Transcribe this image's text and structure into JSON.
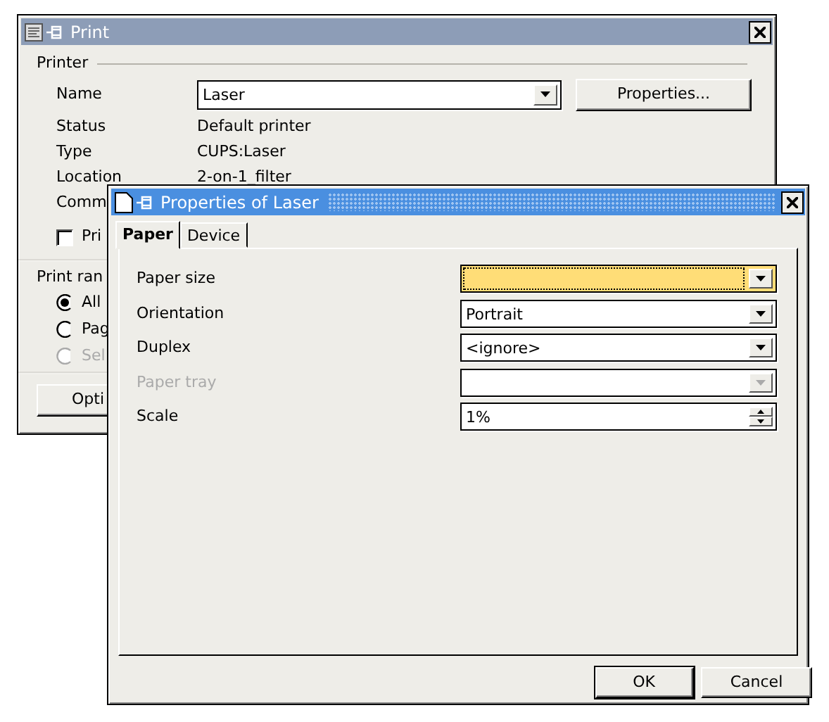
{
  "print_dialog": {
    "title": "Print",
    "printer_group": {
      "label": "Printer",
      "name_label": "Name",
      "name_value": "Laser",
      "properties_button": "Properties...",
      "info": [
        {
          "label": "Status",
          "value": "Default printer"
        },
        {
          "label": "Type",
          "value": "CUPS:Laser"
        },
        {
          "label": "Location",
          "value": "2-on-1_filter"
        },
        {
          "label": "Comm"
        }
      ]
    },
    "print_to_file": {
      "label": "Pri",
      "checked": false
    },
    "range_group": {
      "label": "Print ran",
      "options": [
        {
          "label": "All",
          "selected": true,
          "disabled": false
        },
        {
          "label": "Pag",
          "selected": false,
          "disabled": false
        },
        {
          "label": "Sel",
          "selected": false,
          "disabled": true
        }
      ]
    },
    "options_button": "Opti"
  },
  "properties_dialog": {
    "title": "Properties of Laser",
    "tabs": [
      {
        "label": "Paper",
        "selected": true
      },
      {
        "label": "Device",
        "selected": false
      }
    ],
    "fields": [
      {
        "kind": "combo",
        "label": "Paper size",
        "focused": true,
        "disabled": false
      },
      {
        "kind": "combo",
        "label": "Orientation",
        "value": "Portrait",
        "focused": false,
        "disabled": false
      },
      {
        "kind": "combo",
        "label": "Duplex",
        "value": "<ignore>",
        "focused": false,
        "disabled": false
      },
      {
        "kind": "combo",
        "label": "Paper tray",
        "focused": false,
        "disabled": true
      },
      {
        "kind": "spin",
        "label": "Scale",
        "value": "1%",
        "focused": false,
        "disabled": false
      }
    ],
    "buttons": [
      {
        "label": "OK",
        "default": true
      },
      {
        "label": "Cancel",
        "default": false
      }
    ]
  }
}
